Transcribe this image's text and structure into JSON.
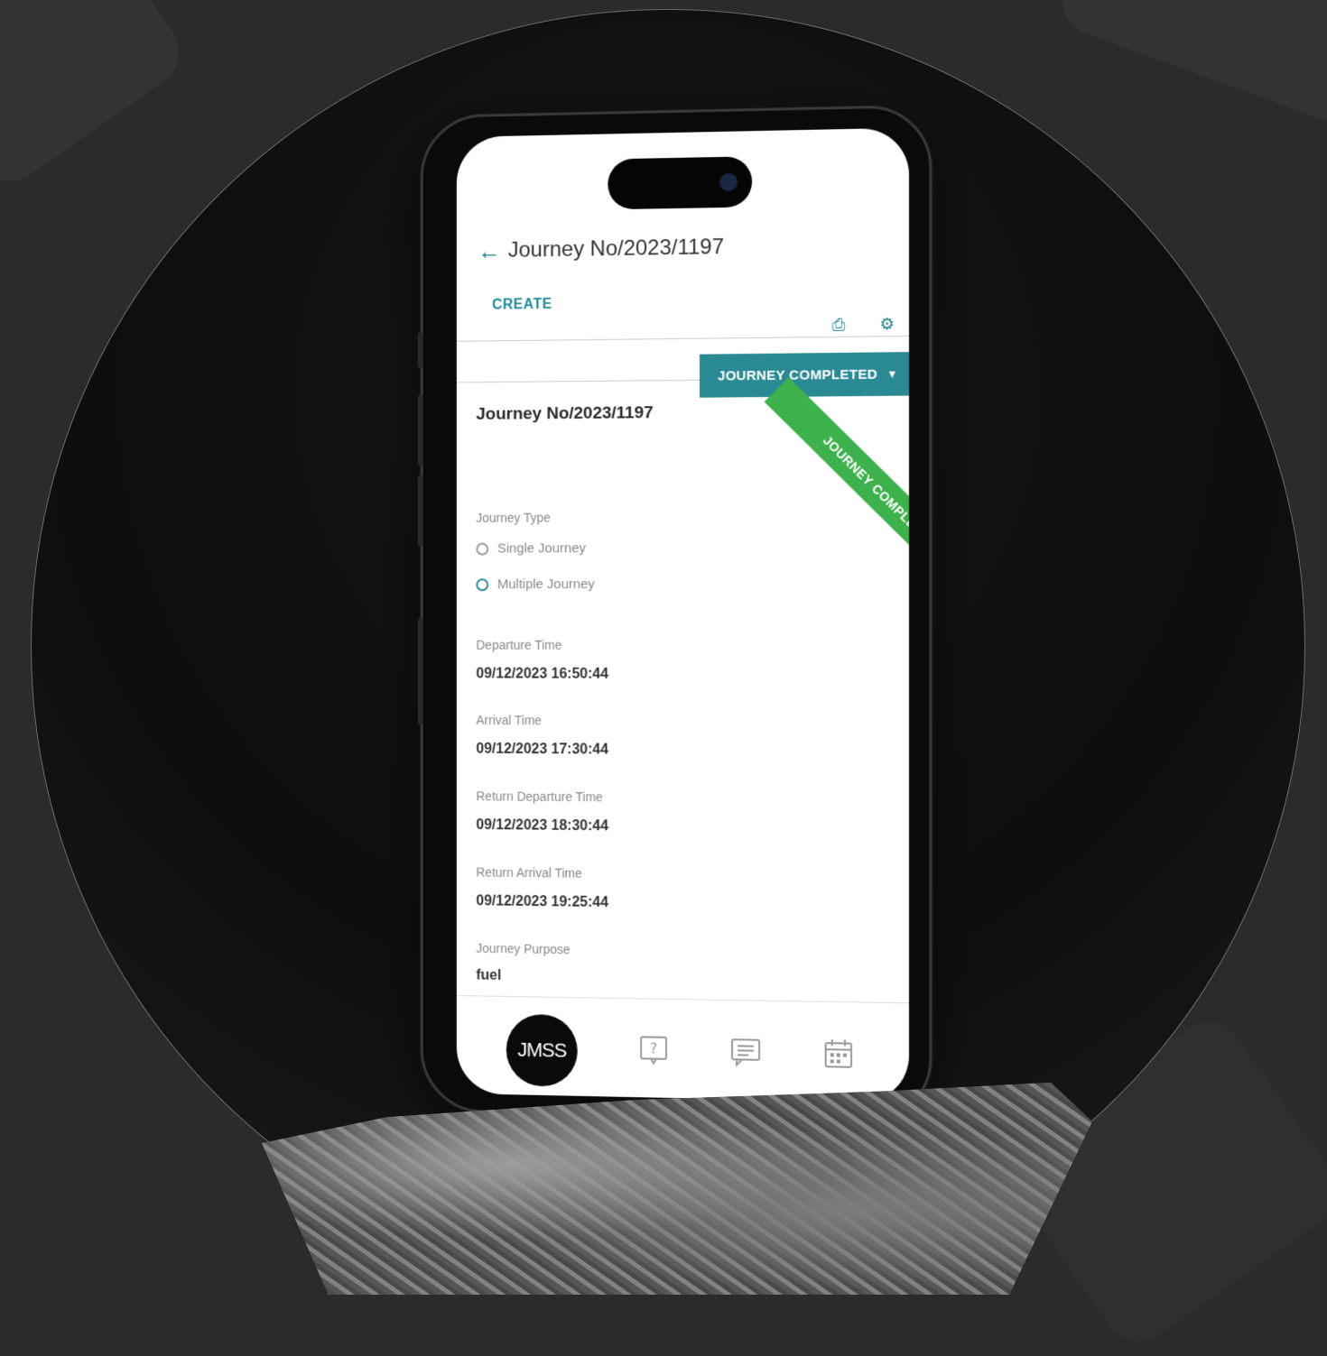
{
  "app": {
    "title": "Journey No/2023/1197",
    "create_label": "CREATE",
    "status_label": "JOURNEY COMPLETED",
    "ribbon_label": "JOURNEY COMPLETED",
    "record_title": "Journey No/2023/1197"
  },
  "form": {
    "journey_type_label": "Journey Type",
    "options": [
      "Single Journey",
      "Multiple Journey"
    ],
    "fields": [
      {
        "label": "Departure Time",
        "value": "09/12/2023 16:50:44"
      },
      {
        "label": "Arrival Time",
        "value": "09/12/2023 17:30:44"
      },
      {
        "label": "Return Departure Time",
        "value": "09/12/2023 18:30:44"
      },
      {
        "label": "Return Arrival Time",
        "value": "09/12/2023 19:25:44"
      },
      {
        "label": "Journey Purpose",
        "value": "fuel"
      }
    ]
  },
  "nav": {
    "logo_text": "JMSS",
    "icons": [
      "help-icon",
      "chat-icon",
      "calendar-icon"
    ]
  },
  "colors": {
    "accent": "#2a8a94",
    "ribbon": "#3db14b"
  }
}
